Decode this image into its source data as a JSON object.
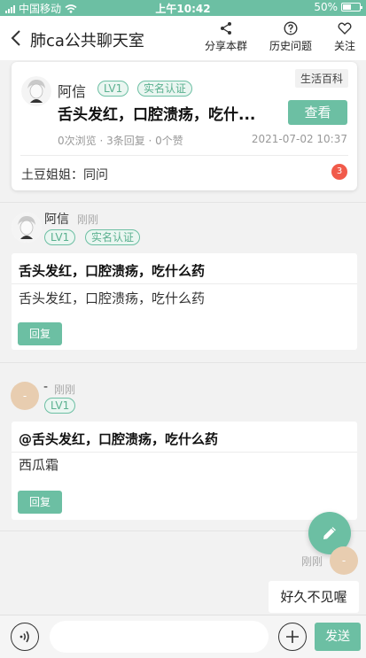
{
  "status_bar": {
    "carrier": "中国移动",
    "time": "上午10:42",
    "battery": "50%",
    "battery_level": 0.5
  },
  "header": {
    "title": "肺ca公共聊天室",
    "share_label": "分享本群",
    "history_label": "历史问题",
    "follow_label": "关注"
  },
  "question_card": {
    "user_name": "阿信",
    "level_tag": "LV1",
    "verified_tag": "实名认证",
    "category": "生活百科",
    "title": "舌头发红，口腔溃疡，吃什...",
    "view_button": "查看",
    "stats": "0次浏览 · 3条回复 · 0个赞",
    "date": "2021-07-02 10:37",
    "latest_reply": "土豆姐姐：同问",
    "reply_count": "3"
  },
  "messages": [
    {
      "user_name": "阿信",
      "time": "刚刚",
      "level_tag": "LV1",
      "verified_tag": "实名认证",
      "quote_title": "舌头发红，口腔溃疡，吃什么药",
      "content": "舌头发红，口腔溃疡，吃什么药",
      "reply_button": "回复"
    },
    {
      "avatar_text": "-",
      "user_name": "-",
      "time": "刚刚",
      "level_tag": "LV1",
      "quote_title": "@舌头发红，口腔溃疡，吃什么药",
      "content": "西瓜霜",
      "reply_button": "回复"
    }
  ],
  "my_message": {
    "time": "刚刚",
    "avatar_text": "-",
    "content": "好久不见喔"
  },
  "input_bar": {
    "placeholder": "",
    "send_label": "发送"
  },
  "colors": {
    "accent": "#6cbfa3",
    "badge_red": "#f15a4a"
  }
}
